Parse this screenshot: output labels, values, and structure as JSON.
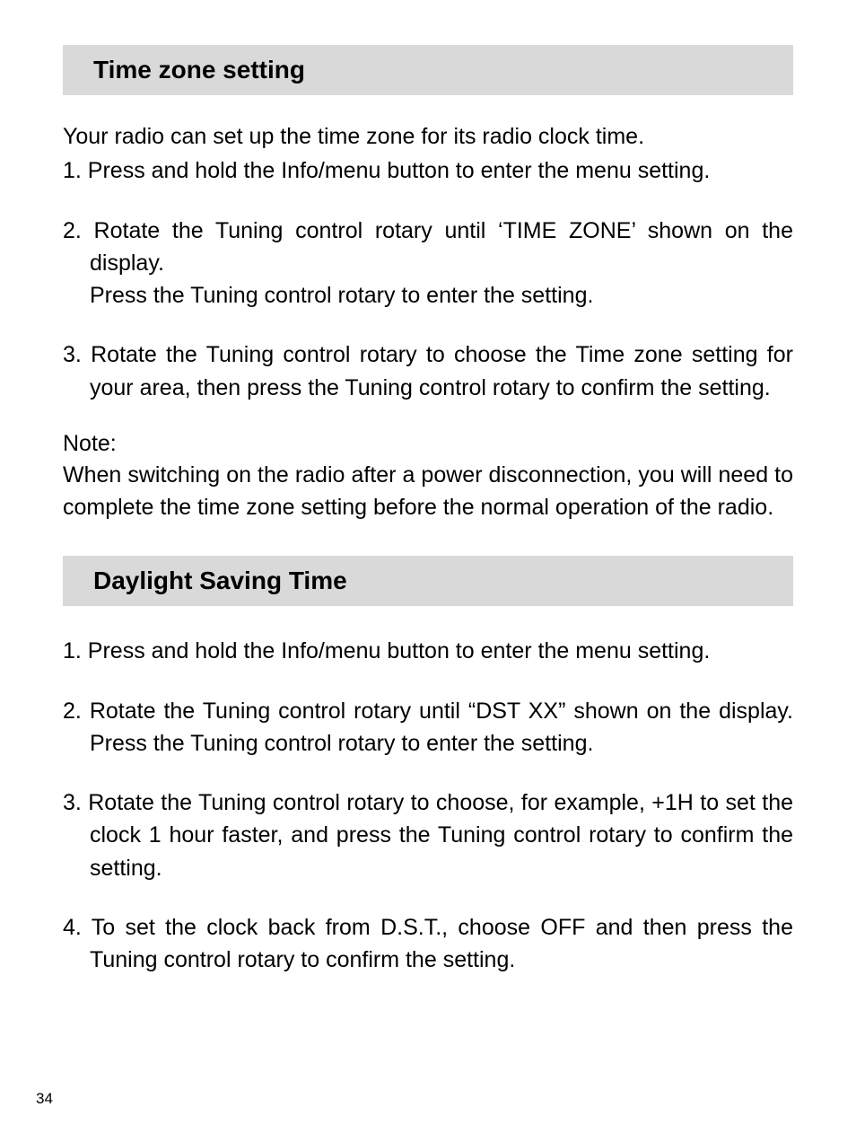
{
  "section1": {
    "heading": "Time zone setting",
    "intro": "Your radio can set up the time zone for its radio clock time.",
    "step1": "1. Press and hold the Info/menu button to enter the menu setting.",
    "step2a": "2. Rotate the Tuning control rotary until ‘TIME ZONE’ shown on the display.",
    "step2b": "Press the Tuning control rotary to enter the setting.",
    "step3": "3. Rotate the Tuning control rotary to choose the Time zone setting for your area, then press the Tuning control rotary to confirm the setting.",
    "noteLabel": "Note:",
    "noteBody": "When switching on the radio after a power disconnection, you will need to complete the time zone setting before the normal operation of the radio."
  },
  "section2": {
    "heading": "Daylight Saving Time",
    "step1": "1. Press and hold the Info/menu button to enter the menu setting.",
    "step2": "2. Rotate the Tuning control rotary until “DST XX” shown on the display. Press the Tuning control rotary to enter the setting.",
    "step3": "3. Rotate the Tuning control rotary to choose, for example, +1H to set the clock 1 hour faster, and press the Tuning control rotary to confirm the setting.",
    "step4": "4. To set the clock back from D.S.T., choose OFF and then press the Tuning control rotary to confirm the setting."
  },
  "pageNumber": "34"
}
